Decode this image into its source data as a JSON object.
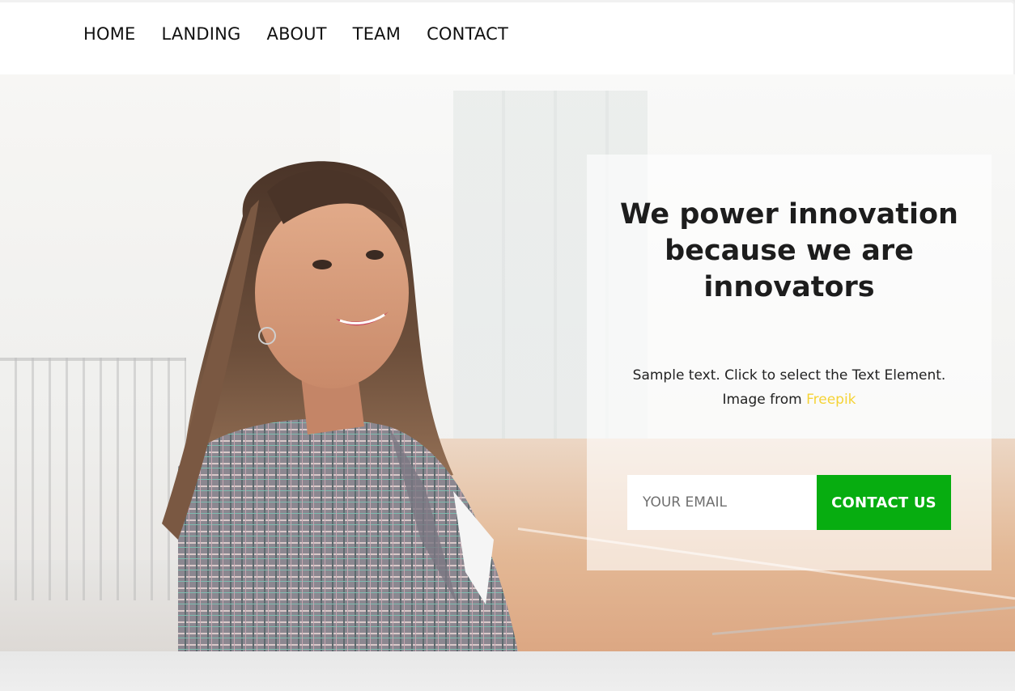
{
  "nav": {
    "items": [
      {
        "label": "HOME"
      },
      {
        "label": "LANDING"
      },
      {
        "label": "ABOUT"
      },
      {
        "label": "TEAM"
      },
      {
        "label": "CONTACT"
      }
    ]
  },
  "hero": {
    "title": "We power innovation because we are innovators",
    "text_prefix": "Sample text. Click to select the Text Element. Image from ",
    "link_label": "Freepik",
    "email_placeholder": "YOUR EMAIL",
    "button_label": "CONTACT US"
  },
  "colors": {
    "accent_button": "#07ad10",
    "link": "#f5d336",
    "text_dark": "#1d1d1d"
  }
}
